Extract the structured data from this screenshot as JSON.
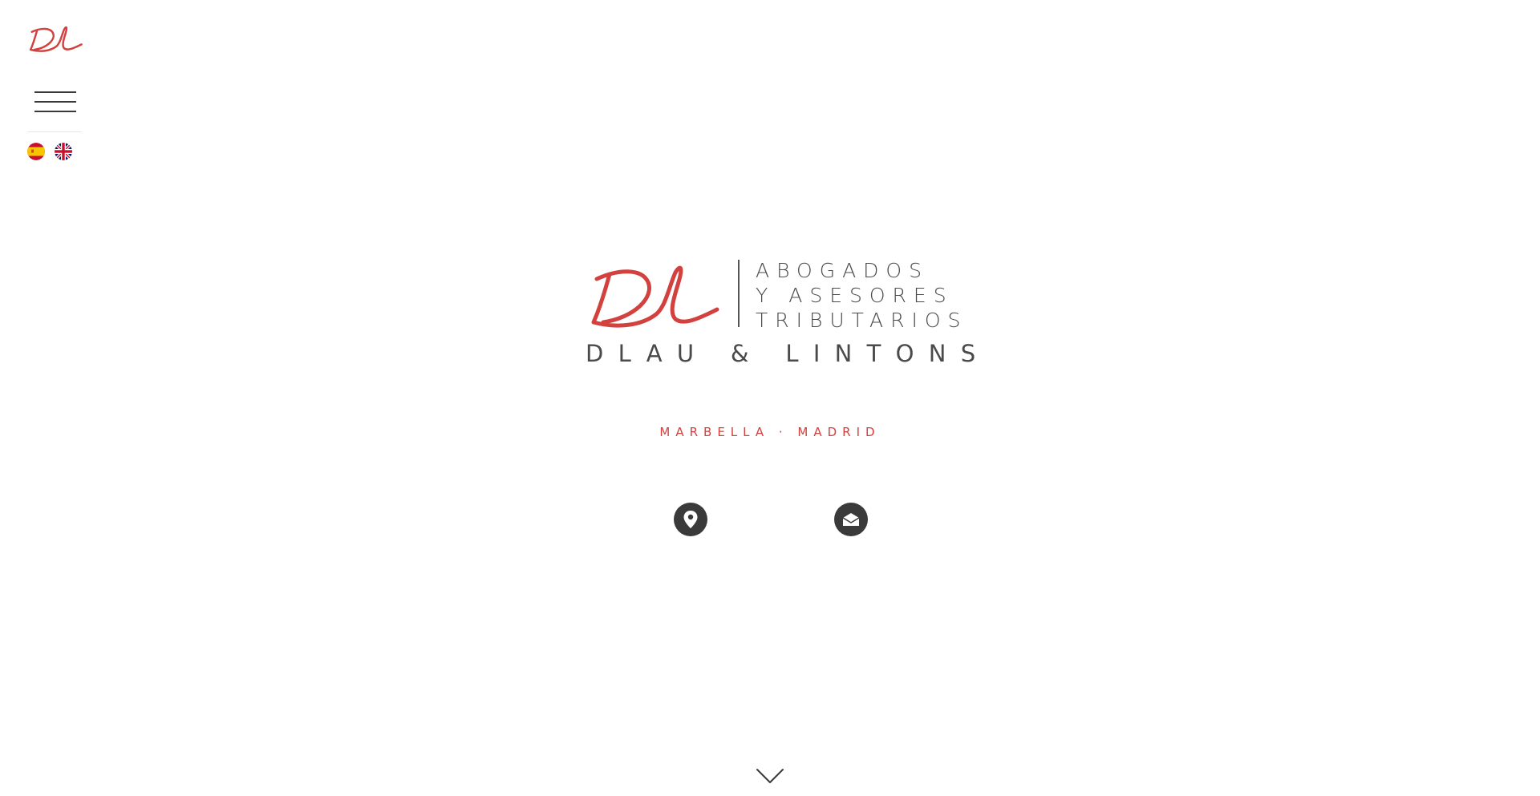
{
  "sidebar": {
    "logo_icon": "dl-signature-logo-icon",
    "menu_icon": "hamburger-menu-icon",
    "languages": [
      {
        "code": "es",
        "icon": "spain-flag-icon"
      },
      {
        "code": "en",
        "icon": "uk-flag-icon"
      }
    ]
  },
  "hero": {
    "tagline_lines": [
      "ABOGADOS",
      "Y ASESORES",
      "TRIBUTARIOS"
    ],
    "firm_name": "DLAU & LINTONS",
    "locations": "MARBELLA · MADRID",
    "icons": [
      "location-pin-icon",
      "email-icon"
    ],
    "scroll_icon": "chevron-down-icon"
  },
  "colors": {
    "brand_red": "#d2413e",
    "text_dark": "#4a4a4a",
    "icon_dark": "#3a3a3a",
    "background": "#ffffff"
  }
}
